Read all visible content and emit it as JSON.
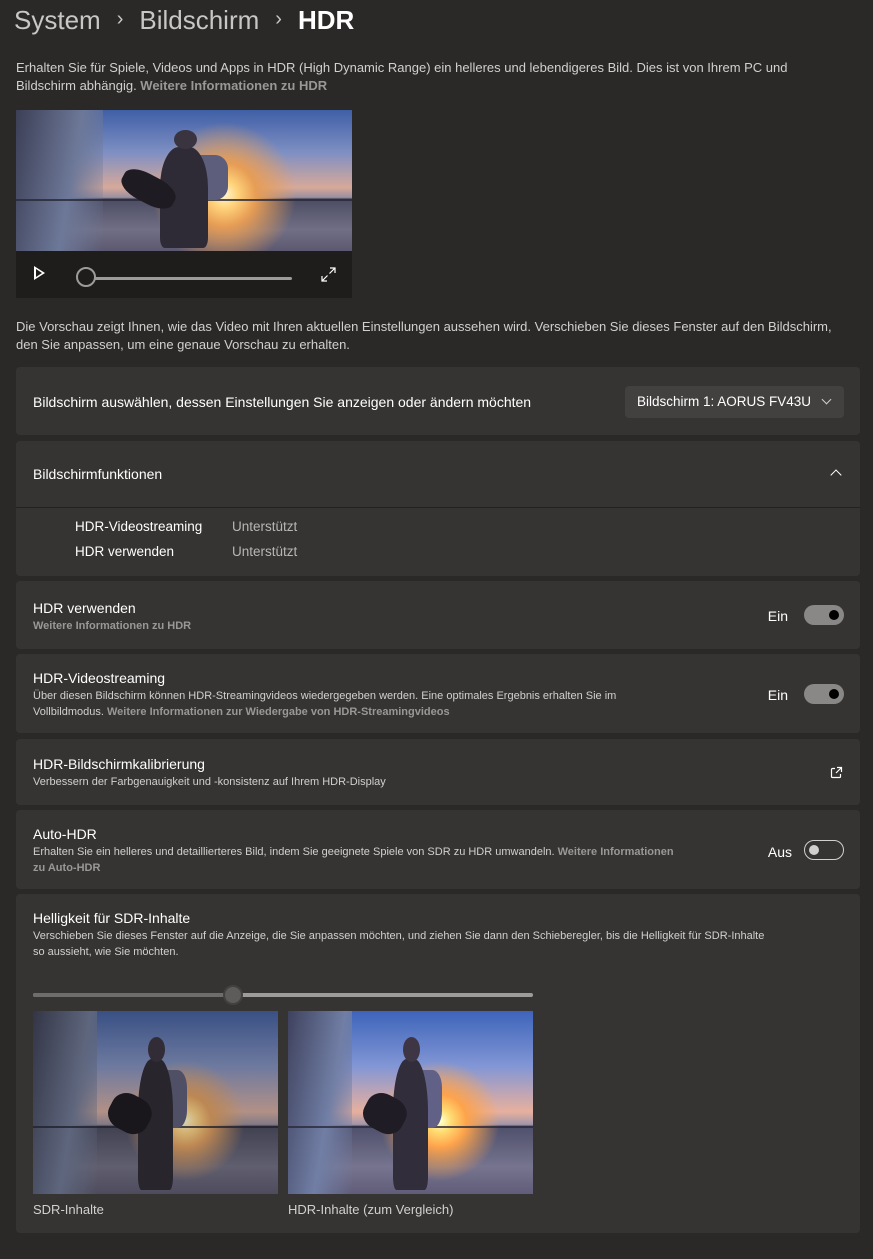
{
  "breadcrumb": {
    "level1": "System",
    "level2": "Bildschirm",
    "current": "HDR",
    "separator": "›"
  },
  "intro": {
    "text": "Erhalten Sie für Spiele, Videos und Apps in HDR (High Dynamic Range) ein helleres und lebendigeres Bild. Dies ist von Ihrem PC und Bildschirm abhängig. ",
    "link": "Weitere Informationen zu HDR"
  },
  "video_preview": {
    "play_icon": "play-icon",
    "fullscreen_icon": "fullscreen-icon",
    "progress": 0
  },
  "preview_note": "Die Vorschau zeigt Ihnen, wie das Video mit Ihren aktuellen Einstellungen aussehen wird. Verschieben Sie dieses Fenster auf den Bildschirm, den Sie anpassen, um eine genaue Vorschau zu erhalten.",
  "display_select": {
    "label": "Bildschirm auswählen, dessen Einstellungen Sie anzeigen oder ändern möchten",
    "selected": "Bildschirm 1: AORUS FV43U"
  },
  "capabilities": {
    "title": "Bildschirmfunktionen",
    "items": [
      {
        "name": "HDR-Videostreaming",
        "value": "Unterstützt"
      },
      {
        "name": "HDR verwenden",
        "value": "Unterstützt"
      }
    ]
  },
  "use_hdr": {
    "title": "HDR verwenden",
    "link": "Weitere Informationen zu HDR",
    "state": "Ein",
    "on": true
  },
  "hdr_streaming": {
    "title": "HDR-Videostreaming",
    "desc_line1": "Über diesen Bildschirm können HDR-Streamingvideos wiedergegeben werden. Eine optimales Ergebnis erhalten Sie im",
    "desc_line2": "Vollbildmodus. ",
    "link": "Weitere Informationen zur Wiedergabe von HDR-Streamingvideos",
    "state": "Ein",
    "on": true
  },
  "calibration": {
    "title": "HDR-Bildschirmkalibrierung",
    "desc": "Verbessern der Farbgenauigkeit und -konsistenz auf Ihrem HDR-Display",
    "icon": "external-link-icon"
  },
  "auto_hdr": {
    "title": "Auto-HDR",
    "desc": "Erhalten Sie ein helleres und detaillierteres Bild, indem Sie geeignete Spiele von SDR zu HDR umwandeln. ",
    "link_part1": "Weitere Informationen",
    "link_part2": "zu Auto-HDR",
    "state": "Aus",
    "on": false
  },
  "sdr_brightness": {
    "title": "Helligkeit für SDR-Inhalte",
    "desc_line1": "Verschieben Sie dieses Fenster auf die Anzeige, die Sie anpassen möchten, und ziehen Sie dann den Schieberegler, bis die Helligkeit für SDR-Inhalte",
    "desc_line2": "so aussieht, wie Sie möchten.",
    "level": 0.4,
    "sdr_label": "SDR-Inhalte",
    "hdr_label": "HDR-Inhalte (zum Vergleich)"
  }
}
